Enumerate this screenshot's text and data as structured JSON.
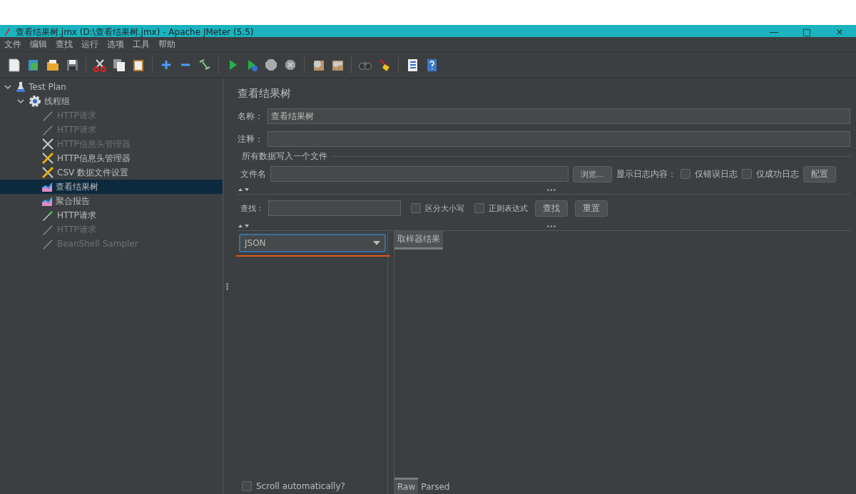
{
  "window": {
    "title": "查看结果树.jmx (D:\\查看结果树.jmx) - Apache JMeter (5.5)",
    "controls": [
      "—",
      "□",
      "×"
    ]
  },
  "menu": [
    "文件",
    "编辑",
    "查找",
    "运行",
    "选项",
    "工具",
    "帮助"
  ],
  "tree": [
    {
      "label": "Test Plan",
      "kind": "plan",
      "expanded": true,
      "disabled": false,
      "selected": false,
      "children": [
        {
          "label": "线程组",
          "kind": "thread_group",
          "expanded": true,
          "disabled": false,
          "selected": false,
          "children": [
            {
              "label": "HTTP请求",
              "kind": "sampler",
              "disabled": true,
              "selected": false
            },
            {
              "label": "HTTP请求",
              "kind": "sampler",
              "disabled": true,
              "selected": false
            },
            {
              "label": "HTTP信息头管理器",
              "kind": "config",
              "disabled": true,
              "selected": false
            },
            {
              "label": "HTTP信息头管理器",
              "kind": "config",
              "disabled": false,
              "selected": false
            },
            {
              "label": "CSV 数据文件设置",
              "kind": "config",
              "disabled": false,
              "selected": false
            },
            {
              "label": "查看结果树",
              "kind": "listener",
              "disabled": false,
              "selected": true
            },
            {
              "label": "聚合报告",
              "kind": "listener",
              "disabled": false,
              "selected": false
            },
            {
              "label": "HTTP请求",
              "kind": "sampler",
              "disabled": false,
              "selected": false
            },
            {
              "label": "HTTP请求",
              "kind": "sampler",
              "disabled": true,
              "selected": false
            },
            {
              "label": "BeanShell Sampler",
              "kind": "sampler",
              "disabled": true,
              "selected": false
            }
          ]
        }
      ]
    }
  ],
  "editor": {
    "title": "查看结果树",
    "name_label": "名称：",
    "name_value": "查看结果树",
    "comment_label": "注释：",
    "file_group": "所有数据写入一个文件",
    "filename_label": "文件名",
    "browse_button": "浏览...",
    "log_label": "显示日志内容：",
    "log_options": [
      {
        "label": "仅错误日志",
        "checked": false
      },
      {
        "label": "仅成功日志",
        "checked": false
      }
    ],
    "config_button": "配置"
  },
  "search": {
    "label": "查找：",
    "options": [
      {
        "label": "区分大小写",
        "checked": false
      },
      {
        "label": "正则表达式",
        "checked": false
      }
    ],
    "buttons": [
      "查找",
      "重置"
    ]
  },
  "results": {
    "renderer": "JSON",
    "scroll": {
      "label": "Scroll automatically?",
      "checked": false
    },
    "tabs": [
      {
        "label": "取样器结果",
        "selected": true
      }
    ],
    "bottom_tabs": [
      {
        "label": "Raw",
        "selected": true
      },
      {
        "label": "Parsed",
        "selected": false
      }
    ]
  }
}
